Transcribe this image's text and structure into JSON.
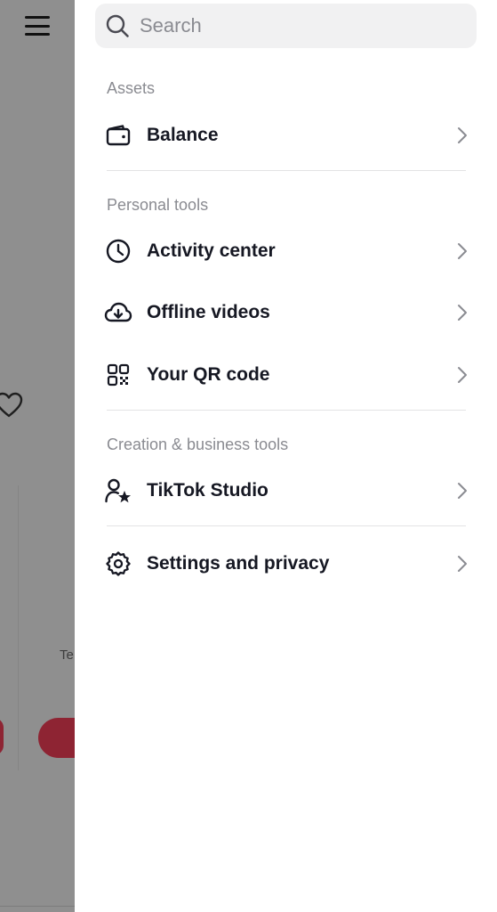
{
  "search": {
    "placeholder": "Search"
  },
  "background": {
    "partial_label": "Te"
  },
  "sections": [
    {
      "title": "Assets",
      "items": [
        {
          "label": "Balance",
          "icon": "wallet-icon"
        }
      ]
    },
    {
      "title": "Personal tools",
      "items": [
        {
          "label": "Activity center",
          "icon": "clock-icon"
        },
        {
          "label": "Offline videos",
          "icon": "cloud-download-icon"
        },
        {
          "label": "Your QR code",
          "icon": "qr-code-icon"
        }
      ]
    },
    {
      "title": "Creation & business tools",
      "items": [
        {
          "label": "TikTok Studio",
          "icon": "user-star-icon"
        }
      ]
    },
    {
      "title": "",
      "items": [
        {
          "label": "Settings and privacy",
          "icon": "gear-icon"
        }
      ]
    }
  ],
  "colors": {
    "text_primary": "#161823",
    "text_secondary": "#8a8b91",
    "overlay": "#8f8f8f",
    "accent_dimmed": "#8e2433",
    "search_bg": "#f1f1f2"
  }
}
